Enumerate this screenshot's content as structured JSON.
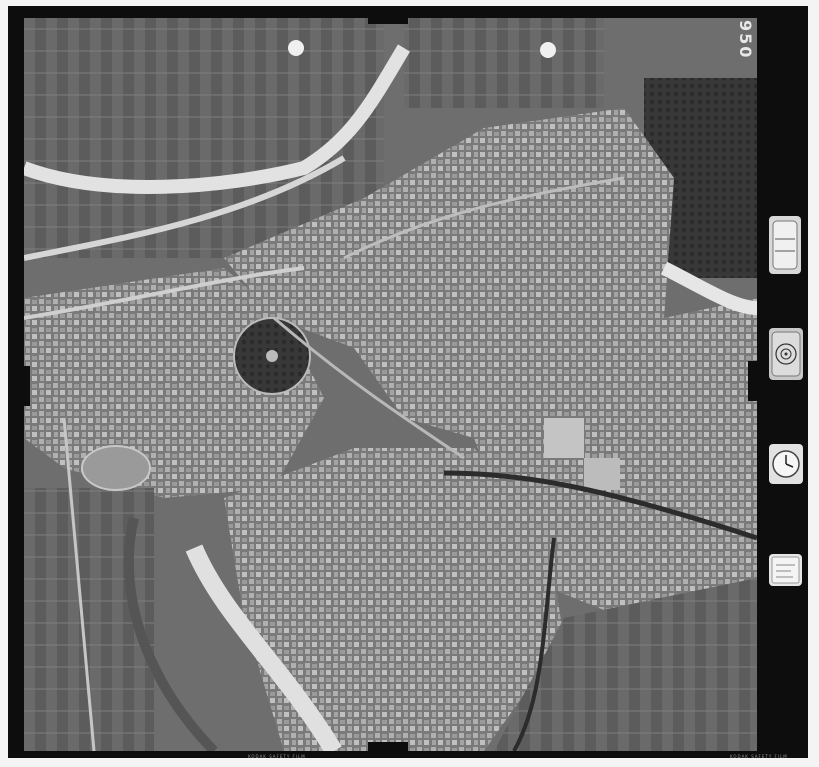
{
  "image": {
    "kind": "aerial-photograph",
    "tone": "black-and-white",
    "subject": "city with river bend and railway"
  },
  "frame_number": "950",
  "edge_print_left": "KODAK SAFETY FILM",
  "edge_print_right": "KODAK SAFETY FILM",
  "colors": {
    "film_border": "#0d0d0d",
    "photo_base": "#6e6e6e",
    "river": "#e2e2e2",
    "dense_city": "#8a8a8a",
    "vegetation": "#3a3a3a"
  }
}
